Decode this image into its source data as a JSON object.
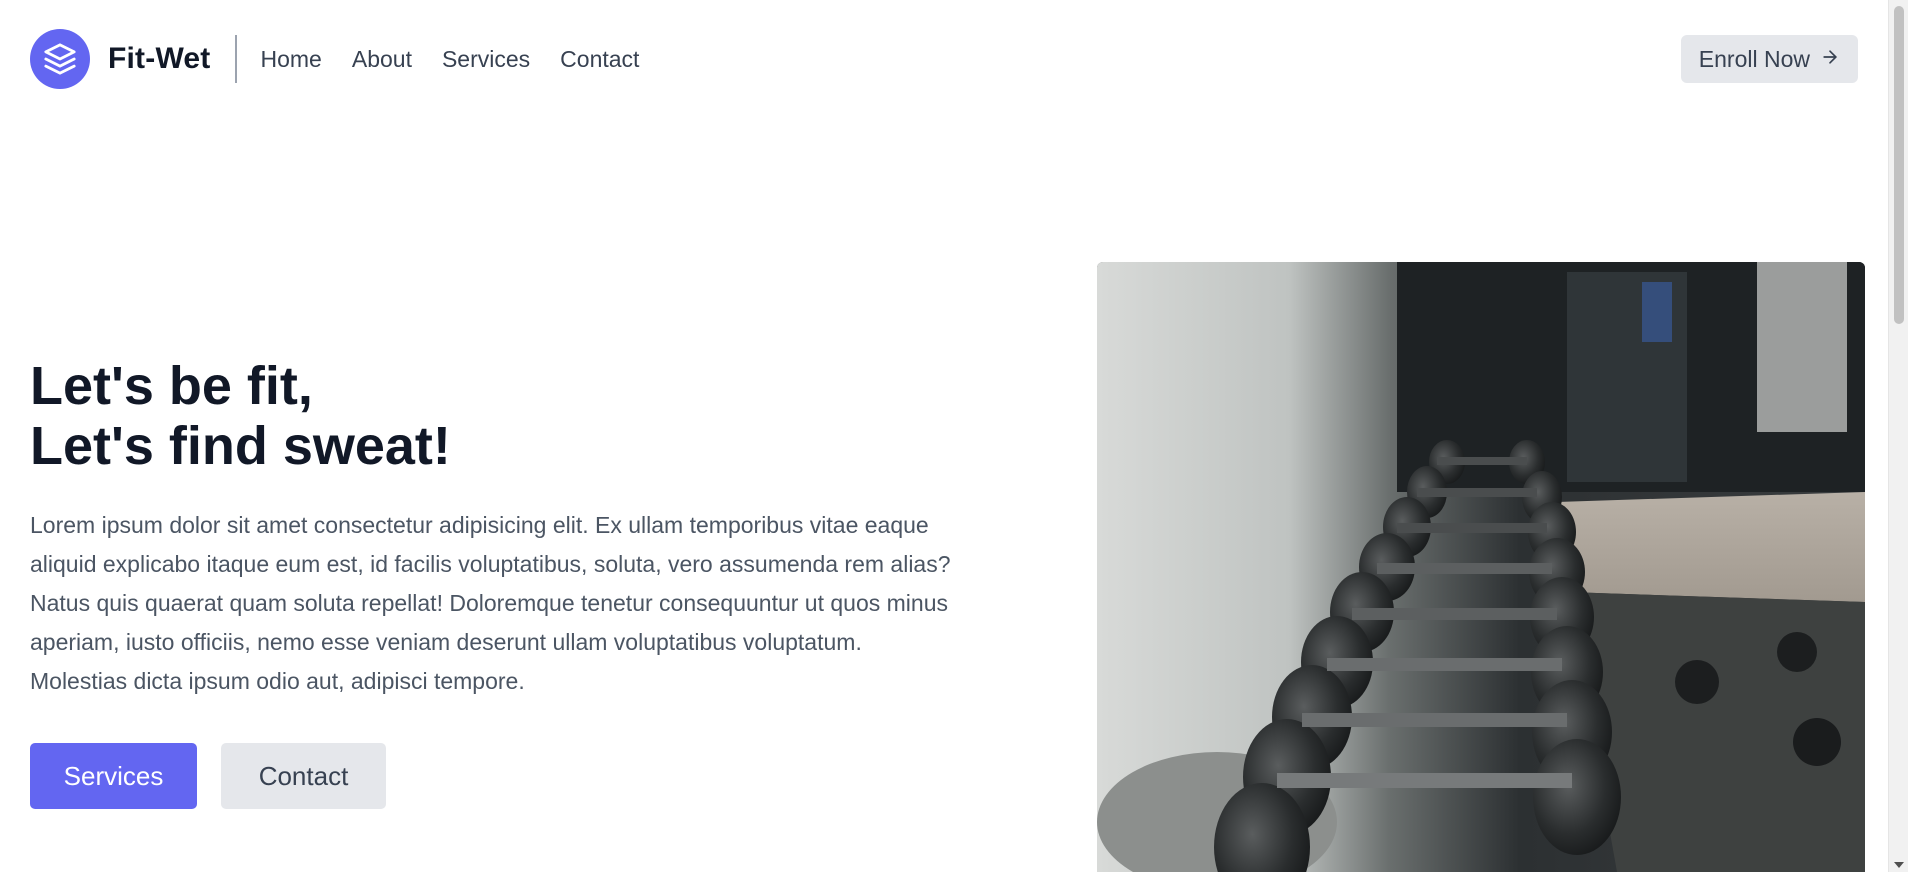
{
  "header": {
    "brand_name": "Fit-Wet",
    "nav": [
      "Home",
      "About",
      "Services",
      "Contact"
    ],
    "enroll_label": "Enroll Now",
    "enroll_arrow": "→"
  },
  "hero": {
    "title_line1": "Let's be fit,",
    "title_line2": "Let's find sweat!",
    "description": "Lorem ipsum dolor sit amet consectetur adipisicing elit. Ex ullam temporibus vitae eaque aliquid explicabo itaque eum est, id facilis voluptatibus, soluta, vero assumenda rem alias? Natus quis quaerat quam soluta repellat! Doloremque tenetur consequuntur ut quos minus aperiam, iusto officiis, nemo esse veniam deserunt ullam voluptatibus voluptatum. Molestias dicta ipsum odio aut, adipisci tempore.",
    "primary_button": "Services",
    "secondary_button": "Contact",
    "image_subject": "gym-dumbbell-rack-photo"
  },
  "colors": {
    "accent": "#6366f1",
    "button_gray": "#e5e7eb",
    "heading": "#111827",
    "body_text": "#4b5563"
  },
  "icons": {
    "logo": "stacked-layers-icon",
    "enroll": "arrow-right-icon"
  }
}
